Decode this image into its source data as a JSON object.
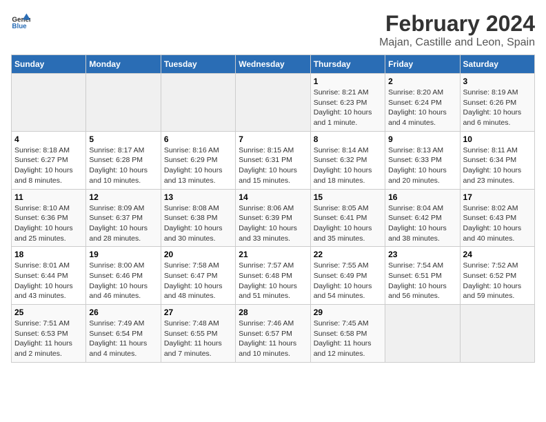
{
  "header": {
    "logo_line1": "General",
    "logo_line2": "Blue",
    "title": "February 2024",
    "subtitle": "Majan, Castille and Leon, Spain"
  },
  "columns": [
    "Sunday",
    "Monday",
    "Tuesday",
    "Wednesday",
    "Thursday",
    "Friday",
    "Saturday"
  ],
  "weeks": [
    [
      {
        "day": "",
        "info": ""
      },
      {
        "day": "",
        "info": ""
      },
      {
        "day": "",
        "info": ""
      },
      {
        "day": "",
        "info": ""
      },
      {
        "day": "1",
        "info": "Sunrise: 8:21 AM\nSunset: 6:23 PM\nDaylight: 10 hours and 1 minute."
      },
      {
        "day": "2",
        "info": "Sunrise: 8:20 AM\nSunset: 6:24 PM\nDaylight: 10 hours and 4 minutes."
      },
      {
        "day": "3",
        "info": "Sunrise: 8:19 AM\nSunset: 6:26 PM\nDaylight: 10 hours and 6 minutes."
      }
    ],
    [
      {
        "day": "4",
        "info": "Sunrise: 8:18 AM\nSunset: 6:27 PM\nDaylight: 10 hours and 8 minutes."
      },
      {
        "day": "5",
        "info": "Sunrise: 8:17 AM\nSunset: 6:28 PM\nDaylight: 10 hours and 10 minutes."
      },
      {
        "day": "6",
        "info": "Sunrise: 8:16 AM\nSunset: 6:29 PM\nDaylight: 10 hours and 13 minutes."
      },
      {
        "day": "7",
        "info": "Sunrise: 8:15 AM\nSunset: 6:31 PM\nDaylight: 10 hours and 15 minutes."
      },
      {
        "day": "8",
        "info": "Sunrise: 8:14 AM\nSunset: 6:32 PM\nDaylight: 10 hours and 18 minutes."
      },
      {
        "day": "9",
        "info": "Sunrise: 8:13 AM\nSunset: 6:33 PM\nDaylight: 10 hours and 20 minutes."
      },
      {
        "day": "10",
        "info": "Sunrise: 8:11 AM\nSunset: 6:34 PM\nDaylight: 10 hours and 23 minutes."
      }
    ],
    [
      {
        "day": "11",
        "info": "Sunrise: 8:10 AM\nSunset: 6:36 PM\nDaylight: 10 hours and 25 minutes."
      },
      {
        "day": "12",
        "info": "Sunrise: 8:09 AM\nSunset: 6:37 PM\nDaylight: 10 hours and 28 minutes."
      },
      {
        "day": "13",
        "info": "Sunrise: 8:08 AM\nSunset: 6:38 PM\nDaylight: 10 hours and 30 minutes."
      },
      {
        "day": "14",
        "info": "Sunrise: 8:06 AM\nSunset: 6:39 PM\nDaylight: 10 hours and 33 minutes."
      },
      {
        "day": "15",
        "info": "Sunrise: 8:05 AM\nSunset: 6:41 PM\nDaylight: 10 hours and 35 minutes."
      },
      {
        "day": "16",
        "info": "Sunrise: 8:04 AM\nSunset: 6:42 PM\nDaylight: 10 hours and 38 minutes."
      },
      {
        "day": "17",
        "info": "Sunrise: 8:02 AM\nSunset: 6:43 PM\nDaylight: 10 hours and 40 minutes."
      }
    ],
    [
      {
        "day": "18",
        "info": "Sunrise: 8:01 AM\nSunset: 6:44 PM\nDaylight: 10 hours and 43 minutes."
      },
      {
        "day": "19",
        "info": "Sunrise: 8:00 AM\nSunset: 6:46 PM\nDaylight: 10 hours and 46 minutes."
      },
      {
        "day": "20",
        "info": "Sunrise: 7:58 AM\nSunset: 6:47 PM\nDaylight: 10 hours and 48 minutes."
      },
      {
        "day": "21",
        "info": "Sunrise: 7:57 AM\nSunset: 6:48 PM\nDaylight: 10 hours and 51 minutes."
      },
      {
        "day": "22",
        "info": "Sunrise: 7:55 AM\nSunset: 6:49 PM\nDaylight: 10 hours and 54 minutes."
      },
      {
        "day": "23",
        "info": "Sunrise: 7:54 AM\nSunset: 6:51 PM\nDaylight: 10 hours and 56 minutes."
      },
      {
        "day": "24",
        "info": "Sunrise: 7:52 AM\nSunset: 6:52 PM\nDaylight: 10 hours and 59 minutes."
      }
    ],
    [
      {
        "day": "25",
        "info": "Sunrise: 7:51 AM\nSunset: 6:53 PM\nDaylight: 11 hours and 2 minutes."
      },
      {
        "day": "26",
        "info": "Sunrise: 7:49 AM\nSunset: 6:54 PM\nDaylight: 11 hours and 4 minutes."
      },
      {
        "day": "27",
        "info": "Sunrise: 7:48 AM\nSunset: 6:55 PM\nDaylight: 11 hours and 7 minutes."
      },
      {
        "day": "28",
        "info": "Sunrise: 7:46 AM\nSunset: 6:57 PM\nDaylight: 11 hours and 10 minutes."
      },
      {
        "day": "29",
        "info": "Sunrise: 7:45 AM\nSunset: 6:58 PM\nDaylight: 11 hours and 12 minutes."
      },
      {
        "day": "",
        "info": ""
      },
      {
        "day": "",
        "info": ""
      }
    ]
  ]
}
